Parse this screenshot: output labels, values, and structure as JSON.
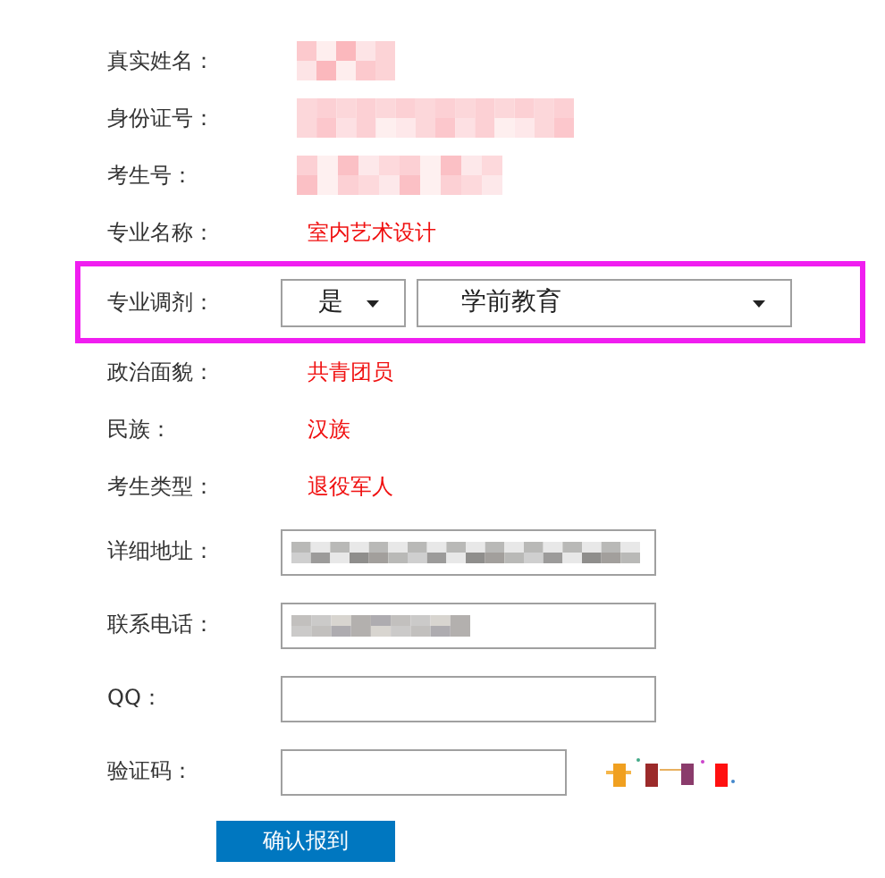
{
  "form": {
    "rows": [
      {
        "kind": "blurred",
        "label": "真实姓名："
      },
      {
        "kind": "blurred",
        "label": "身份证号："
      },
      {
        "kind": "blurred",
        "label": "考生号："
      },
      {
        "kind": "text",
        "label": "专业名称：",
        "value": "室内艺术设计"
      },
      {
        "kind": "select",
        "label": "专业调剂：",
        "highlighted": true,
        "selects": [
          {
            "value": "是"
          },
          {
            "value": "学前教育"
          }
        ]
      },
      {
        "kind": "text",
        "label": "政治面貌：",
        "value": "共青团员"
      },
      {
        "kind": "text",
        "label": "民族：",
        "value": "汉族"
      },
      {
        "kind": "text",
        "label": "考生类型：",
        "value": "退役军人"
      },
      {
        "kind": "input-blurred",
        "label": "详细地址："
      },
      {
        "kind": "input-blurred",
        "label": "联系电话："
      },
      {
        "kind": "input",
        "label": "QQ："
      },
      {
        "kind": "captcha",
        "label": "验证码："
      }
    ],
    "submit": "确认报到"
  }
}
